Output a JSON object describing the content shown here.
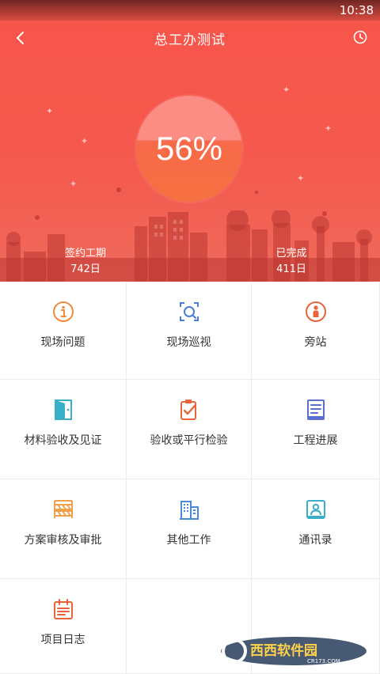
{
  "status_bar": {
    "time": "10:38"
  },
  "header": {
    "title": "总工办测试",
    "progress": "56%",
    "progress_value": 0.56,
    "left_stat": {
      "label": "签约工期",
      "value": "742日"
    },
    "right_stat": {
      "label": "已完成",
      "value": "411日"
    }
  },
  "menu": [
    {
      "label": "现场问题",
      "icon": "info-icon",
      "color": "#f08a3c"
    },
    {
      "label": "现场巡视",
      "icon": "inspection-camera-icon",
      "color": "#4a7dd6"
    },
    {
      "label": "旁站",
      "icon": "person-station-icon",
      "color": "#e8643c"
    },
    {
      "label": "材料验收及见证",
      "icon": "door-icon",
      "color": "#3ab0c8"
    },
    {
      "label": "验收或平行检验",
      "icon": "clipboard-check-icon",
      "color": "#e8643c"
    },
    {
      "label": "工程进展",
      "icon": "document-list-icon",
      "color": "#5a6fcf"
    },
    {
      "label": "方案审核及审批",
      "icon": "barrier-icon",
      "color": "#f0a04a"
    },
    {
      "label": "其他工作",
      "icon": "building-icon",
      "color": "#4a8ad6"
    },
    {
      "label": "通讯录",
      "icon": "contact-book-icon",
      "color": "#3ab0c8"
    },
    {
      "label": "项目日志",
      "icon": "calendar-log-icon",
      "color": "#e8643c"
    }
  ],
  "watermark": {
    "text": "西西软件园",
    "subtext": "CR173.COM"
  }
}
